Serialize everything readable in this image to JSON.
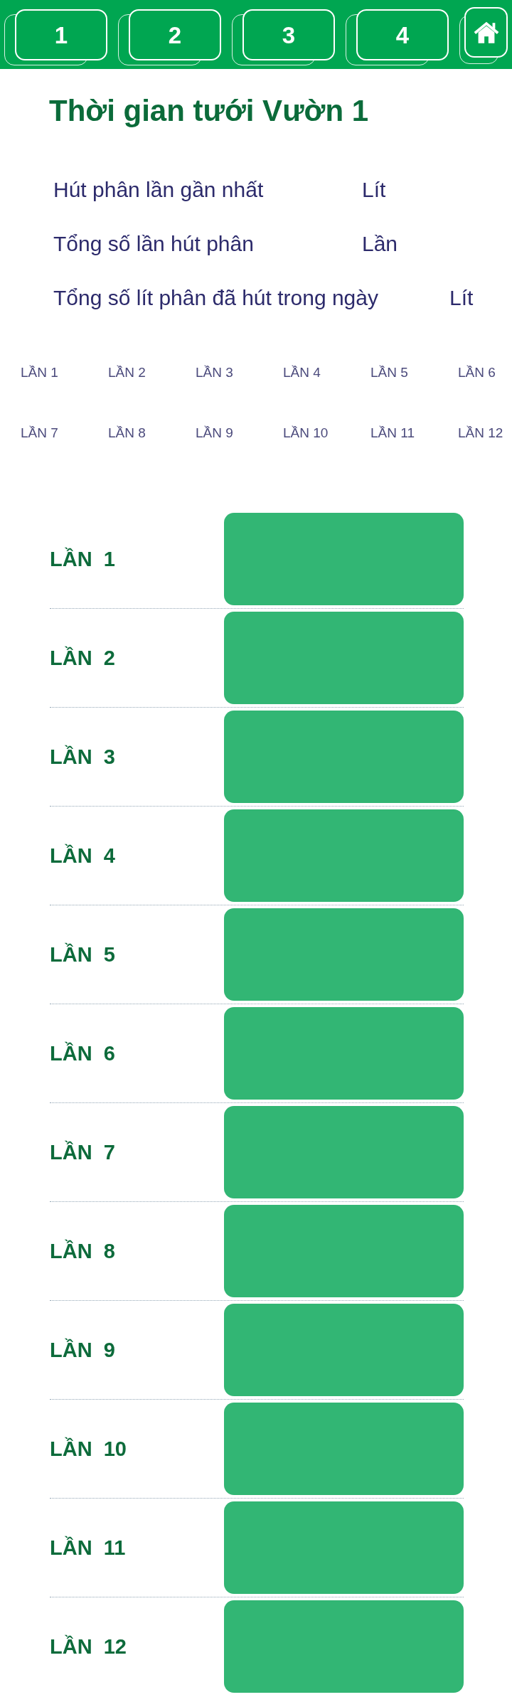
{
  "nav": [
    {
      "kind": "tab",
      "label": "1"
    },
    {
      "kind": "tab",
      "label": "2"
    },
    {
      "kind": "tab",
      "label": "3"
    },
    {
      "kind": "tab",
      "label": "4"
    },
    {
      "kind": "home"
    }
  ],
  "title": "Thời gian tưới Vườn 1",
  "summary": [
    {
      "label": "Hút phân lần gần nhất",
      "unit": "Lít"
    },
    {
      "label": "Tổng số lần hút phân",
      "unit": "Lần"
    },
    {
      "label": "Tổng số lít phân đã hút trong ngày",
      "unit": "Lít"
    }
  ],
  "times_grid": [
    "LẦN 1",
    "LẦN 2",
    "LẦN 3",
    "LẦN 4",
    "LẦN 5",
    "LẦN 6",
    "LẦN 7",
    "LẦN 8",
    "LẦN 9",
    "LẦN 10",
    "LẦN 11",
    "LẦN 12"
  ],
  "schedule": [
    {
      "label": "LẦN  1"
    },
    {
      "label": "LẦN  2"
    },
    {
      "label": "LẦN  3"
    },
    {
      "label": "LẦN  4"
    },
    {
      "label": "LẦN  5"
    },
    {
      "label": "LẦN  6"
    },
    {
      "label": "LẦN  7"
    },
    {
      "label": "LẦN  8"
    },
    {
      "label": "LẦN  9"
    },
    {
      "label": "LẦN  10"
    },
    {
      "label": "LẦN  11"
    },
    {
      "label": "LẦN  12"
    }
  ]
}
